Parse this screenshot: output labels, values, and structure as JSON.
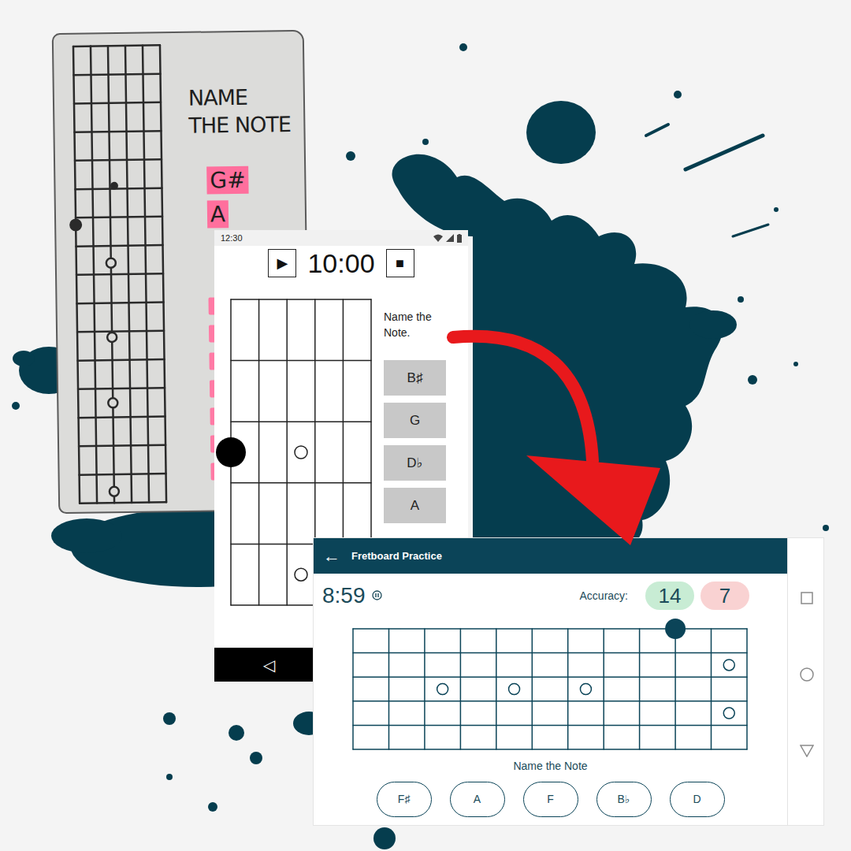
{
  "sketch": {
    "title": [
      "NAME",
      "THE NOTE"
    ],
    "answers": [
      "G#",
      "A"
    ],
    "fretboard": {
      "cols": 5,
      "rows": 16,
      "markers": [
        {
          "col": 0,
          "row": 6.25,
          "kind": "filled"
        },
        {
          "col": 2.25,
          "row": 4.9,
          "kind": "small"
        },
        {
          "col": 2,
          "row": 7.6,
          "kind": "open"
        },
        {
          "col": 2,
          "row": 10.2,
          "kind": "open"
        },
        {
          "col": 2,
          "row": 12.5,
          "kind": "open"
        },
        {
          "col": 2,
          "row": 15.6,
          "kind": "open"
        }
      ]
    }
  },
  "wireframe": {
    "status_time": "12:30",
    "play": "▶",
    "timer": "10:00",
    "stop": "■",
    "fretboard": {
      "cols": 5,
      "rows": 5,
      "markers": [
        {
          "col": 0,
          "row": 2.5,
          "kind": "filled"
        },
        {
          "col": 2.5,
          "row": 2.5,
          "kind": "open"
        },
        {
          "col": 2.5,
          "row": 4.5,
          "kind": "open"
        }
      ]
    },
    "prompt": "Name the Note.",
    "options": [
      "B♯",
      "G",
      "D♭",
      "A"
    ],
    "nav_back": "◁"
  },
  "app": {
    "back": "←",
    "title": "Fretboard Practice",
    "timer": "8:59",
    "accuracy_label": "Accuracy:",
    "correct": "14",
    "wrong": "7",
    "fretboard": {
      "cols": 11,
      "rows": 5,
      "markers": [
        {
          "col": 9,
          "row": 0,
          "kind": "filled"
        },
        {
          "col": 10.5,
          "row": 1.5,
          "kind": "open"
        },
        {
          "col": 2.5,
          "row": 2.5,
          "kind": "open"
        },
        {
          "col": 4.5,
          "row": 2.5,
          "kind": "open"
        },
        {
          "col": 6.5,
          "row": 2.5,
          "kind": "open"
        },
        {
          "col": 10.5,
          "row": 3.5,
          "kind": "open"
        }
      ]
    },
    "prompt": "Name the Note",
    "options": [
      "F♯",
      "A",
      "F",
      "B♭",
      "D"
    ]
  }
}
